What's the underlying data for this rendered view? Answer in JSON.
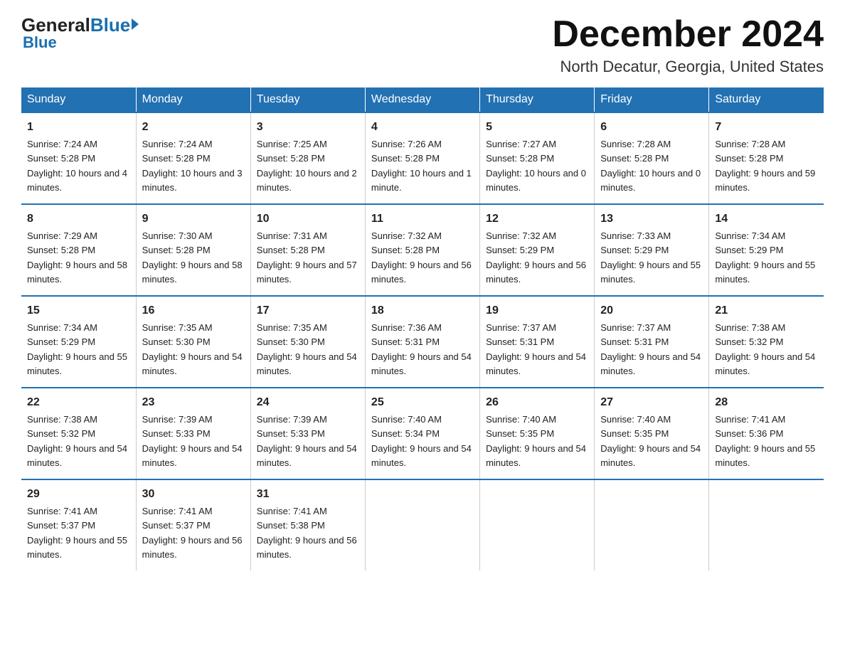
{
  "header": {
    "logo_general": "General",
    "logo_blue": "Blue",
    "month_title": "December 2024",
    "location": "North Decatur, Georgia, United States"
  },
  "days_of_week": [
    "Sunday",
    "Monday",
    "Tuesday",
    "Wednesday",
    "Thursday",
    "Friday",
    "Saturday"
  ],
  "weeks": [
    [
      {
        "day": "1",
        "sunrise": "7:24 AM",
        "sunset": "5:28 PM",
        "daylight": "10 hours and 4 minutes."
      },
      {
        "day": "2",
        "sunrise": "7:24 AM",
        "sunset": "5:28 PM",
        "daylight": "10 hours and 3 minutes."
      },
      {
        "day": "3",
        "sunrise": "7:25 AM",
        "sunset": "5:28 PM",
        "daylight": "10 hours and 2 minutes."
      },
      {
        "day": "4",
        "sunrise": "7:26 AM",
        "sunset": "5:28 PM",
        "daylight": "10 hours and 1 minute."
      },
      {
        "day": "5",
        "sunrise": "7:27 AM",
        "sunset": "5:28 PM",
        "daylight": "10 hours and 0 minutes."
      },
      {
        "day": "6",
        "sunrise": "7:28 AM",
        "sunset": "5:28 PM",
        "daylight": "10 hours and 0 minutes."
      },
      {
        "day": "7",
        "sunrise": "7:28 AM",
        "sunset": "5:28 PM",
        "daylight": "9 hours and 59 minutes."
      }
    ],
    [
      {
        "day": "8",
        "sunrise": "7:29 AM",
        "sunset": "5:28 PM",
        "daylight": "9 hours and 58 minutes."
      },
      {
        "day": "9",
        "sunrise": "7:30 AM",
        "sunset": "5:28 PM",
        "daylight": "9 hours and 58 minutes."
      },
      {
        "day": "10",
        "sunrise": "7:31 AM",
        "sunset": "5:28 PM",
        "daylight": "9 hours and 57 minutes."
      },
      {
        "day": "11",
        "sunrise": "7:32 AM",
        "sunset": "5:28 PM",
        "daylight": "9 hours and 56 minutes."
      },
      {
        "day": "12",
        "sunrise": "7:32 AM",
        "sunset": "5:29 PM",
        "daylight": "9 hours and 56 minutes."
      },
      {
        "day": "13",
        "sunrise": "7:33 AM",
        "sunset": "5:29 PM",
        "daylight": "9 hours and 55 minutes."
      },
      {
        "day": "14",
        "sunrise": "7:34 AM",
        "sunset": "5:29 PM",
        "daylight": "9 hours and 55 minutes."
      }
    ],
    [
      {
        "day": "15",
        "sunrise": "7:34 AM",
        "sunset": "5:29 PM",
        "daylight": "9 hours and 55 minutes."
      },
      {
        "day": "16",
        "sunrise": "7:35 AM",
        "sunset": "5:30 PM",
        "daylight": "9 hours and 54 minutes."
      },
      {
        "day": "17",
        "sunrise": "7:35 AM",
        "sunset": "5:30 PM",
        "daylight": "9 hours and 54 minutes."
      },
      {
        "day": "18",
        "sunrise": "7:36 AM",
        "sunset": "5:31 PM",
        "daylight": "9 hours and 54 minutes."
      },
      {
        "day": "19",
        "sunrise": "7:37 AM",
        "sunset": "5:31 PM",
        "daylight": "9 hours and 54 minutes."
      },
      {
        "day": "20",
        "sunrise": "7:37 AM",
        "sunset": "5:31 PM",
        "daylight": "9 hours and 54 minutes."
      },
      {
        "day": "21",
        "sunrise": "7:38 AM",
        "sunset": "5:32 PM",
        "daylight": "9 hours and 54 minutes."
      }
    ],
    [
      {
        "day": "22",
        "sunrise": "7:38 AM",
        "sunset": "5:32 PM",
        "daylight": "9 hours and 54 minutes."
      },
      {
        "day": "23",
        "sunrise": "7:39 AM",
        "sunset": "5:33 PM",
        "daylight": "9 hours and 54 minutes."
      },
      {
        "day": "24",
        "sunrise": "7:39 AM",
        "sunset": "5:33 PM",
        "daylight": "9 hours and 54 minutes."
      },
      {
        "day": "25",
        "sunrise": "7:40 AM",
        "sunset": "5:34 PM",
        "daylight": "9 hours and 54 minutes."
      },
      {
        "day": "26",
        "sunrise": "7:40 AM",
        "sunset": "5:35 PM",
        "daylight": "9 hours and 54 minutes."
      },
      {
        "day": "27",
        "sunrise": "7:40 AM",
        "sunset": "5:35 PM",
        "daylight": "9 hours and 54 minutes."
      },
      {
        "day": "28",
        "sunrise": "7:41 AM",
        "sunset": "5:36 PM",
        "daylight": "9 hours and 55 minutes."
      }
    ],
    [
      {
        "day": "29",
        "sunrise": "7:41 AM",
        "sunset": "5:37 PM",
        "daylight": "9 hours and 55 minutes."
      },
      {
        "day": "30",
        "sunrise": "7:41 AM",
        "sunset": "5:37 PM",
        "daylight": "9 hours and 56 minutes."
      },
      {
        "day": "31",
        "sunrise": "7:41 AM",
        "sunset": "5:38 PM",
        "daylight": "9 hours and 56 minutes."
      },
      null,
      null,
      null,
      null
    ]
  ]
}
